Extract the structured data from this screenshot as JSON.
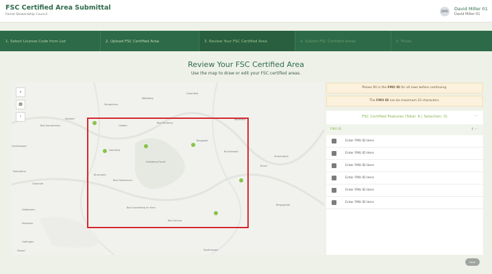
{
  "header": {
    "title": "FSC Certified Area Submittal",
    "subtitle": "Forest Stewardship Council",
    "user": {
      "initials": "DMO",
      "name": "David Miller 01",
      "sub": "David Miller 01"
    }
  },
  "steps": [
    {
      "label": "1. Select License Code from List",
      "state": "done"
    },
    {
      "label": "2. Upload FSC Certified Area",
      "state": "done"
    },
    {
      "label": "3. Review Your FSC Certified Area",
      "state": "active"
    },
    {
      "label": "4. Submit FSC Certified Areas",
      "state": "pending"
    },
    {
      "label": "5. Finish",
      "state": "pending"
    }
  ],
  "main": {
    "heading": "Review Your FSC Certified Area",
    "subheading": "Use the map to draw or edit your FSC certified areas."
  },
  "map": {
    "controls": {
      "search": "search-icon",
      "layers": "layers-icon",
      "collapse": "chevron-icon"
    },
    "labels": [
      "Greenfeld",
      "Waldberg",
      "Sangerhorn",
      "Seedorf",
      "Bad Sonderheim",
      "Bad Neuberg",
      "Ostfeld",
      "Wildmark",
      "Gerderwood",
      "Deerfield",
      "Bergwald",
      "Bucherwald",
      "Stroombach",
      "Holtsberg Forest",
      "Rhein",
      "Brumwald",
      "Bad Ostenbrunn",
      "Bad Lauterberg im Harz",
      "Bad Sachsa",
      "Nordhausen",
      "Bergsgrode",
      "Osterode",
      "Hildesheim",
      "Gottingen",
      "Dassel",
      "Northeim",
      "Edersteine"
    ],
    "selection_rect_color": "#d7262d",
    "point_color": "#88c34a"
  },
  "notices": [
    {
      "pre": "Please fill in the ",
      "bold": "FMU ID",
      "post": " for all rows before continuing."
    },
    {
      "pre": "The ",
      "bold": "FMU ID",
      "post": " can be maximum 10 characters."
    }
  ],
  "features": {
    "header": "FSC Certified Features (Total: 6 | Selection: 0)",
    "more": "···",
    "column": "FMU ID",
    "column_sort": "↕ ···",
    "rows": [
      "Enter FMU ID Here",
      "Enter FMU ID Here",
      "Enter FMU ID Here",
      "Enter FMU ID Here",
      "Enter FMU ID Here",
      "Enter FMU ID Here"
    ]
  },
  "footer": {
    "next_label": "Next"
  },
  "colors": {
    "brand": "#2e6b4c",
    "steps_bg": "#2d6a47",
    "accent_green": "#84b44d",
    "notice_bg": "#fbf1dc"
  }
}
